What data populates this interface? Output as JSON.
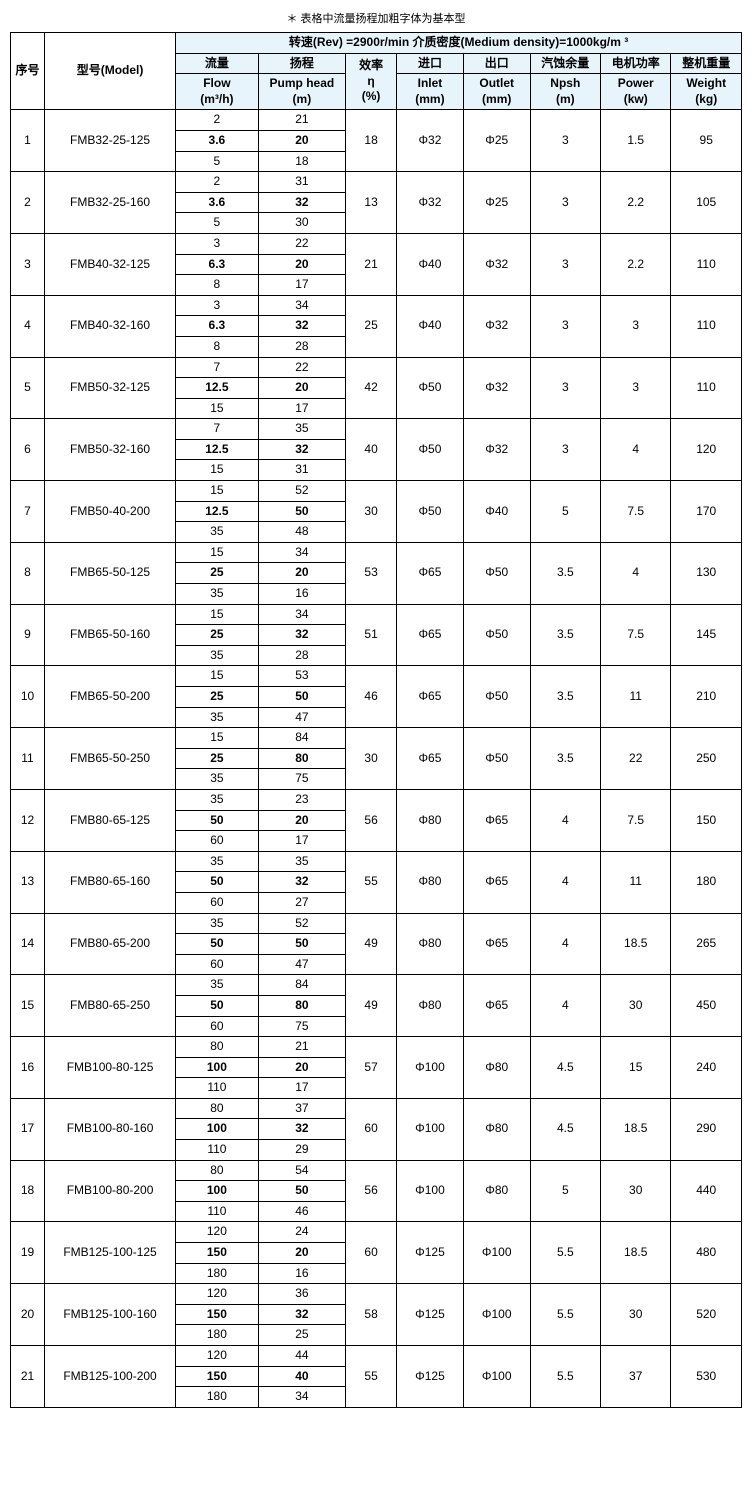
{
  "title": "＊ 表格中流量扬程加粗字体为基本型",
  "subtitle": "转速(Rev) =2900r/min  介质密度(Medium density)=1000kg/m ³",
  "headers": {
    "no": "序号",
    "model": "型号(Model)",
    "flow": "流量",
    "flow_sub": "Flow",
    "flow_unit": "(m³/h)",
    "head": "扬程",
    "head_sub": "Pump head",
    "head_unit": "(m)",
    "eff": "效率",
    "eff_sub": "η",
    "eff_unit": "(%)",
    "inlet": "进口",
    "inlet_sub": "Inlet",
    "inlet_unit": "(mm)",
    "outlet": "出口",
    "outlet_sub": "Outlet",
    "outlet_unit": "(mm)",
    "npsh": "汽蚀余量",
    "npsh_sub": "Npsh",
    "npsh_unit": "(m)",
    "power": "电机功率",
    "power_sub": "Power",
    "power_unit": "(kw)",
    "weight": "整机重量",
    "weight_sub": "Weight",
    "weight_unit": "(kg)"
  },
  "rows": [
    {
      "no": "1",
      "model": "FMB32-25-125",
      "flows": [
        "2",
        "3.6",
        "5"
      ],
      "heads": [
        "21",
        "20",
        "18"
      ],
      "bold_flow": "3.6",
      "bold_head": "20",
      "eff": "18",
      "inlet": "Φ32",
      "outlet": "Φ25",
      "npsh": "3",
      "power": "1.5",
      "weight": "95"
    },
    {
      "no": "2",
      "model": "FMB32-25-160",
      "flows": [
        "2",
        "3.6",
        "5"
      ],
      "heads": [
        "31",
        "32",
        "30"
      ],
      "bold_flow": "3.6",
      "bold_head": "32",
      "eff": "13",
      "inlet": "Φ32",
      "outlet": "Φ25",
      "npsh": "3",
      "power": "2.2",
      "weight": "105"
    },
    {
      "no": "3",
      "model": "FMB40-32-125",
      "flows": [
        "3",
        "6.3",
        "8"
      ],
      "heads": [
        "22",
        "20",
        "17"
      ],
      "bold_flow": "6.3",
      "bold_head": "20",
      "eff": "21",
      "inlet": "Φ40",
      "outlet": "Φ32",
      "npsh": "3",
      "power": "2.2",
      "weight": "110"
    },
    {
      "no": "4",
      "model": "FMB40-32-160",
      "flows": [
        "3",
        "6.3",
        "8"
      ],
      "heads": [
        "34",
        "32",
        "28"
      ],
      "bold_flow": "6.3",
      "bold_head": "32",
      "eff": "25",
      "inlet": "Φ40",
      "outlet": "Φ32",
      "npsh": "3",
      "power": "3",
      "weight": "110"
    },
    {
      "no": "5",
      "model": "FMB50-32-125",
      "flows": [
        "7",
        "12.5",
        "15"
      ],
      "heads": [
        "22",
        "20",
        "17"
      ],
      "bold_flow": "12.5",
      "bold_head": "20",
      "eff": "42",
      "inlet": "Φ50",
      "outlet": "Φ32",
      "npsh": "3",
      "power": "3",
      "weight": "110"
    },
    {
      "no": "6",
      "model": "FMB50-32-160",
      "flows": [
        "7",
        "12.5",
        "15"
      ],
      "heads": [
        "35",
        "32",
        "31"
      ],
      "bold_flow": "12.5",
      "bold_head": "32",
      "eff": "40",
      "inlet": "Φ50",
      "outlet": "Φ32",
      "npsh": "3",
      "power": "4",
      "weight": "120"
    },
    {
      "no": "7",
      "model": "FMB50-40-200",
      "flows": [
        "15",
        "12.5",
        "35"
      ],
      "heads": [
        "52",
        "50",
        "48"
      ],
      "bold_flow": "12.5",
      "bold_head": "50",
      "eff": "30",
      "inlet": "Φ50",
      "outlet": "Φ40",
      "npsh": "5",
      "power": "7.5",
      "weight": "170"
    },
    {
      "no": "8",
      "model": "FMB65-50-125",
      "flows": [
        "15",
        "25",
        "35"
      ],
      "heads": [
        "34",
        "20",
        "16"
      ],
      "bold_flow": "25",
      "bold_head": "20",
      "eff": "53",
      "inlet": "Φ65",
      "outlet": "Φ50",
      "npsh": "3.5",
      "power": "4",
      "weight": "130"
    },
    {
      "no": "9",
      "model": "FMB65-50-160",
      "flows": [
        "15",
        "25",
        "35"
      ],
      "heads": [
        "34",
        "32",
        "28"
      ],
      "bold_flow": "25",
      "bold_head": "32",
      "eff": "51",
      "inlet": "Φ65",
      "outlet": "Φ50",
      "npsh": "3.5",
      "power": "7.5",
      "weight": "145"
    },
    {
      "no": "10",
      "model": "FMB65-50-200",
      "flows": [
        "15",
        "25",
        "35"
      ],
      "heads": [
        "53",
        "50",
        "47"
      ],
      "bold_flow": "25",
      "bold_head": "50",
      "eff": "46",
      "inlet": "Φ65",
      "outlet": "Φ50",
      "npsh": "3.5",
      "power": "11",
      "weight": "210"
    },
    {
      "no": "11",
      "model": "FMB65-50-250",
      "flows": [
        "15",
        "25",
        "35"
      ],
      "heads": [
        "84",
        "80",
        "75"
      ],
      "bold_flow": "25",
      "bold_head": "80",
      "eff": "30",
      "inlet": "Φ65",
      "outlet": "Φ50",
      "npsh": "3.5",
      "power": "22",
      "weight": "250"
    },
    {
      "no": "12",
      "model": "FMB80-65-125",
      "flows": [
        "35",
        "50",
        "60"
      ],
      "heads": [
        "23",
        "20",
        "17"
      ],
      "bold_flow": "50",
      "bold_head": "20",
      "eff": "56",
      "inlet": "Φ80",
      "outlet": "Φ65",
      "npsh": "4",
      "power": "7.5",
      "weight": "150"
    },
    {
      "no": "13",
      "model": "FMB80-65-160",
      "flows": [
        "35",
        "50",
        "60"
      ],
      "heads": [
        "35",
        "32",
        "27"
      ],
      "bold_flow": "50",
      "bold_head": "32",
      "eff": "55",
      "inlet": "Φ80",
      "outlet": "Φ65",
      "npsh": "4",
      "power": "11",
      "weight": "180"
    },
    {
      "no": "14",
      "model": "FMB80-65-200",
      "flows": [
        "35",
        "50",
        "60"
      ],
      "heads": [
        "52",
        "50",
        "47"
      ],
      "bold_flow": "50",
      "bold_head": "50",
      "eff": "49",
      "inlet": "Φ80",
      "outlet": "Φ65",
      "npsh": "4",
      "power": "18.5",
      "weight": "265"
    },
    {
      "no": "15",
      "model": "FMB80-65-250",
      "flows": [
        "35",
        "50",
        "60"
      ],
      "heads": [
        "84",
        "80",
        "75"
      ],
      "bold_flow": "50",
      "bold_head": "80",
      "eff": "49",
      "inlet": "Φ80",
      "outlet": "Φ65",
      "npsh": "4",
      "power": "30",
      "weight": "450"
    },
    {
      "no": "16",
      "model": "FMB100-80-125",
      "flows": [
        "80",
        "100",
        "110"
      ],
      "heads": [
        "21",
        "20",
        "17"
      ],
      "bold_flow": "100",
      "bold_head": "20",
      "eff": "57",
      "inlet": "Φ100",
      "outlet": "Φ80",
      "npsh": "4.5",
      "power": "15",
      "weight": "240"
    },
    {
      "no": "17",
      "model": "FMB100-80-160",
      "flows": [
        "80",
        "100",
        "110"
      ],
      "heads": [
        "37",
        "32",
        "29"
      ],
      "bold_flow": "100",
      "bold_head": "32",
      "eff": "60",
      "inlet": "Φ100",
      "outlet": "Φ80",
      "npsh": "4.5",
      "power": "18.5",
      "weight": "290"
    },
    {
      "no": "18",
      "model": "FMB100-80-200",
      "flows": [
        "80",
        "100",
        "110"
      ],
      "heads": [
        "54",
        "50",
        "46"
      ],
      "bold_flow": "100",
      "bold_head": "50",
      "eff": "56",
      "inlet": "Φ100",
      "outlet": "Φ80",
      "npsh": "5",
      "power": "30",
      "weight": "440"
    },
    {
      "no": "19",
      "model": "FMB125-100-125",
      "flows": [
        "120",
        "150",
        "180"
      ],
      "heads": [
        "24",
        "20",
        "16"
      ],
      "bold_flow": "150",
      "bold_head": "20",
      "eff": "60",
      "inlet": "Φ125",
      "outlet": "Φ100",
      "npsh": "5.5",
      "power": "18.5",
      "weight": "480"
    },
    {
      "no": "20",
      "model": "FMB125-100-160",
      "flows": [
        "120",
        "150",
        "180"
      ],
      "heads": [
        "36",
        "32",
        "25"
      ],
      "bold_flow": "150",
      "bold_head": "32",
      "eff": "58",
      "inlet": "Φ125",
      "outlet": "Φ100",
      "npsh": "5.5",
      "power": "30",
      "weight": "520"
    },
    {
      "no": "21",
      "model": "FMB125-100-200",
      "flows": [
        "120",
        "150",
        "180"
      ],
      "heads": [
        "44",
        "40",
        "34"
      ],
      "bold_flow": "150",
      "bold_head": "40",
      "eff": "55",
      "inlet": "Φ125",
      "outlet": "Φ100",
      "npsh": "5.5",
      "power": "37",
      "weight": "530"
    }
  ]
}
